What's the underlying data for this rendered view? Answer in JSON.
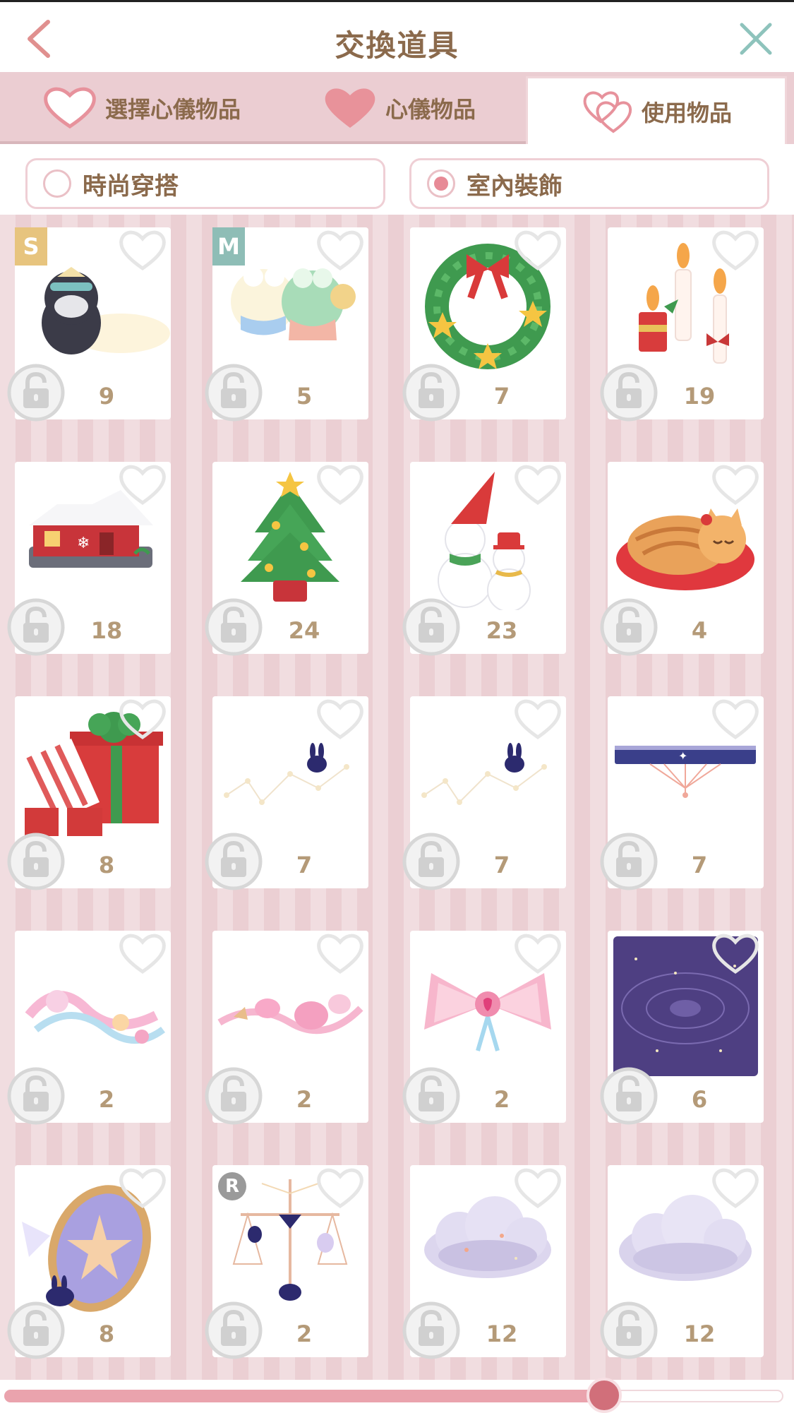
{
  "header": {
    "title": "交換道具",
    "back_icon": "chevron-left-icon",
    "close_icon": "close-icon"
  },
  "tabs": [
    {
      "label": "選擇心儀物品",
      "icon": "heart-outline-icon",
      "active": false
    },
    {
      "label": "心儀物品",
      "icon": "heart-filled-icon",
      "active": false
    },
    {
      "label": "使用物品",
      "icon": "double-heart-icon",
      "active": true
    }
  ],
  "filters": [
    {
      "label": "時尚穿搭",
      "selected": false
    },
    {
      "label": "室內裝飾",
      "selected": true
    }
  ],
  "items": [
    {
      "count": "9",
      "rank": "S",
      "art": "penguin-cat-plush"
    },
    {
      "count": "5",
      "rank": "M",
      "art": "twin-plush-friends"
    },
    {
      "count": "7",
      "rank": "",
      "art": "christmas-wreath"
    },
    {
      "count": "19",
      "rank": "",
      "art": "christmas-candles"
    },
    {
      "count": "18",
      "rank": "",
      "art": "snowy-red-house"
    },
    {
      "count": "24",
      "rank": "",
      "art": "christmas-tree"
    },
    {
      "count": "23",
      "rank": "",
      "art": "snowmen"
    },
    {
      "count": "4",
      "rank": "",
      "art": "sleeping-cat-cushion"
    },
    {
      "count": "8",
      "rank": "",
      "art": "gift-boxes"
    },
    {
      "count": "7",
      "rank": "",
      "art": "constellation-bunny"
    },
    {
      "count": "7",
      "rank": "",
      "art": "constellation-bunny"
    },
    {
      "count": "7",
      "rank": "",
      "art": "celestial-shelf"
    },
    {
      "count": "2",
      "rank": "",
      "art": "pastel-ribbon-pile"
    },
    {
      "count": "2",
      "rank": "",
      "art": "pink-ribbon-garland"
    },
    {
      "count": "2",
      "rank": "",
      "art": "pink-bow"
    },
    {
      "count": "6",
      "rank": "",
      "art": "night-sky-rug"
    },
    {
      "count": "8",
      "rank": "",
      "art": "star-mirror"
    },
    {
      "count": "2",
      "rank": "R",
      "art": "bunny-scale-decor"
    },
    {
      "count": "12",
      "rank": "",
      "art": "starry-cloud"
    },
    {
      "count": "12",
      "rank": "",
      "art": "plain-cloud"
    }
  ],
  "scroll": {
    "progress": 0.77
  },
  "colors": {
    "accent": "#e78a96",
    "text": "#8b6a4c",
    "count": "#b49a78",
    "tabbar": "#ebcdd2"
  }
}
